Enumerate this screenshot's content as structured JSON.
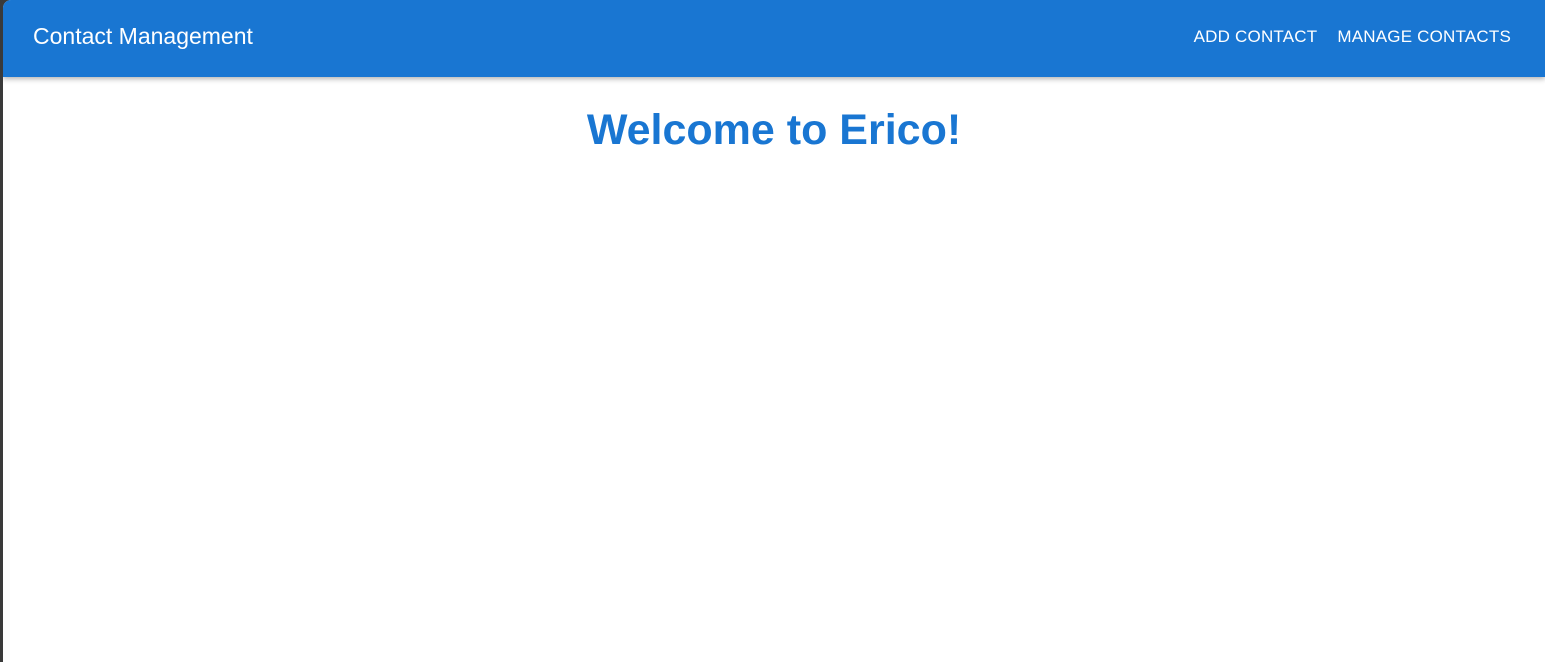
{
  "appbar": {
    "title": "Contact Management",
    "nav": [
      "ADD CONTACT",
      "MANAGE CONTACTS"
    ],
    "color": "#1976d2"
  },
  "main": {
    "heading": "Welcome to Erico!"
  }
}
